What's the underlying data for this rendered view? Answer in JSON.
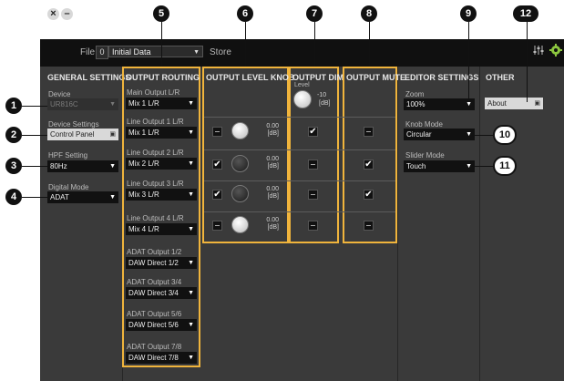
{
  "titlebar": {
    "file_label": "File",
    "preset_number": "0",
    "preset_name": "Initial Data",
    "store_label": "Store"
  },
  "general": {
    "heading": "GENERAL SETTINGS",
    "device_label": "Device",
    "device_value": "UR816C",
    "device_settings_label": "Device Settings",
    "control_panel_label": "Control Panel",
    "hpf_label": "HPF Setting",
    "hpf_value": "80Hz",
    "digital_mode_label": "Digital Mode",
    "digital_mode_value": "ADAT"
  },
  "routing": {
    "heading": "OUTPUT ROUTING",
    "items": [
      {
        "label": "Main Output L/R",
        "value": "Mix 1 L/R"
      },
      {
        "label": "Line Output 1 L/R",
        "value": "Mix 1 L/R"
      },
      {
        "label": "Line Output 2 L/R",
        "value": "Mix 2 L/R"
      },
      {
        "label": "Line Output 3 L/R",
        "value": "Mix 3 L/R"
      },
      {
        "label": "Line Output 4 L/R",
        "value": "Mix 4 L/R"
      },
      {
        "label": "ADAT Output 1/2",
        "value": "DAW Direct 1/2"
      },
      {
        "label": "ADAT Output 3/4",
        "value": "DAW Direct 3/4"
      },
      {
        "label": "ADAT Output 5/6",
        "value": "DAW Direct 5/6"
      },
      {
        "label": "ADAT Output 7/8",
        "value": "DAW Direct 7/8"
      }
    ]
  },
  "level_knob": {
    "heading": "OUTPUT LEVEL KNOB",
    "rows": [
      {
        "checked": false,
        "knob": "light",
        "value": "0.00",
        "unit": "[dB]"
      },
      {
        "checked": true,
        "knob": "dark",
        "value": "0.00",
        "unit": "[dB]"
      },
      {
        "checked": true,
        "knob": "dark",
        "value": "0.00",
        "unit": "[dB]"
      },
      {
        "checked": false,
        "knob": "light",
        "value": "0.00",
        "unit": "[dB]"
      }
    ]
  },
  "dim": {
    "heading": "OUTPUT DIM",
    "level_label": "Level",
    "level_value": "-10",
    "level_unit": "[dB]",
    "rows": [
      true,
      false,
      false,
      false
    ]
  },
  "mute": {
    "heading": "OUTPUT MUTE",
    "rows": [
      false,
      true,
      true,
      false
    ]
  },
  "editor": {
    "heading": "EDITOR SETTINGS",
    "zoom_label": "Zoom",
    "zoom_value": "100%",
    "knob_mode_label": "Knob Mode",
    "knob_mode_value": "Circular",
    "slider_mode_label": "Slider Mode",
    "slider_mode_value": "Touch"
  },
  "other": {
    "heading": "OTHER",
    "about_label": "About"
  },
  "callouts": [
    "1",
    "2",
    "3",
    "4",
    "5",
    "6",
    "7",
    "8",
    "9",
    "10",
    "11",
    "12"
  ],
  "colors": {
    "highlight": "#f0b43c",
    "window_bg": "#3a3a3a",
    "titlebar_bg": "#101010",
    "callout_bg": "#111111",
    "accent_green": "#8cc63f"
  }
}
